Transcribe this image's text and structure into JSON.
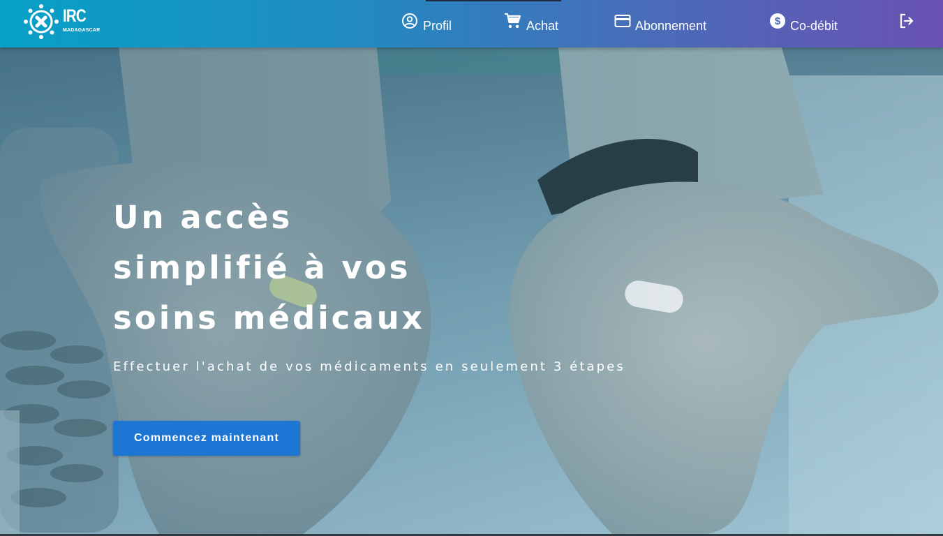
{
  "brand": {
    "name": "IRC",
    "subtitle": "MADAGASCAR",
    "icon": "medical-cross-logo-icon"
  },
  "nav": {
    "items": [
      {
        "id": "profil",
        "label": "Profil",
        "icon": "user-circle-icon"
      },
      {
        "id": "achat",
        "label": "Achat",
        "icon": "shopping-cart-icon"
      },
      {
        "id": "abonnement",
        "label": "Abonnement",
        "icon": "credit-card-icon"
      },
      {
        "id": "codebit",
        "label": "Co-débit",
        "icon": "dollar-circle-icon"
      }
    ],
    "logout_icon": "logout-icon"
  },
  "hero": {
    "headline_lines": [
      "Un accès",
      "simplifié à vos",
      "soins médicaux"
    ],
    "subline": "Effectuer l'achat de vos médicaments en seulement 3 étapes",
    "cta_label": "Commencez maintenant",
    "background": "hands-holding-pills-photo"
  },
  "colors": {
    "nav_gradient_start": "#07a0c6",
    "nav_gradient_end": "#6a51b1",
    "cta": "#1e76d4",
    "text": "#ffffff"
  }
}
